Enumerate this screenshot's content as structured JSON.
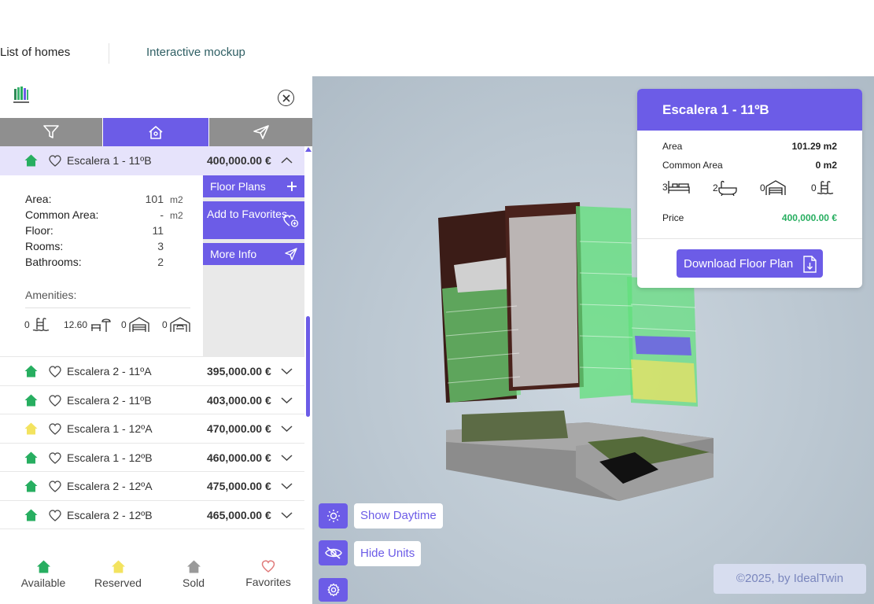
{
  "top_tabs": {
    "list": "List of homes",
    "mockup": "Interactive mockup"
  },
  "colors": {
    "accent": "#6c5ce7",
    "available": "#27ae60",
    "reserved": "#f3e35f",
    "sold": "#9a9a9a",
    "favorite": "#e07a7a"
  },
  "expanded": {
    "name": "Escalera 1 - 11ºB",
    "price": "400,000.00 €",
    "status": "available",
    "specs": [
      {
        "label": "Area:",
        "value": "101",
        "unit": "m2"
      },
      {
        "label": "Common Area:",
        "value": "-",
        "unit": "m2"
      },
      {
        "label": "Floor:",
        "value": "11",
        "unit": ""
      },
      {
        "label": "Rooms:",
        "value": "3",
        "unit": ""
      },
      {
        "label": "Bathrooms:",
        "value": "2",
        "unit": ""
      }
    ],
    "amenities_title": "Amenities:",
    "amenities": [
      {
        "value": "0",
        "icon": "pool-icon"
      },
      {
        "value": "12.60",
        "icon": "terrace-icon"
      },
      {
        "value": "0",
        "icon": "garage-icon"
      },
      {
        "value": "0",
        "icon": "storage-garage-icon"
      }
    ],
    "actions": {
      "floor_plans": "Floor Plans",
      "add_favorites": "Add to Favorites",
      "more_info": "More Info"
    }
  },
  "rows": [
    {
      "name": "Escalera 2 - 11ºA",
      "price": "395,000.00 €",
      "status": "available"
    },
    {
      "name": "Escalera 2 - 11ºB",
      "price": "403,000.00 €",
      "status": "available"
    },
    {
      "name": "Escalera 1 - 12ºA",
      "price": "470,000.00 €",
      "status": "reserved"
    },
    {
      "name": "Escalera 1 - 12ºB",
      "price": "460,000.00 €",
      "status": "available"
    },
    {
      "name": "Escalera 2 - 12ºA",
      "price": "475,000.00 €",
      "status": "available"
    },
    {
      "name": "Escalera 2 - 12ºB",
      "price": "465,000.00 €",
      "status": "available"
    }
  ],
  "legend": {
    "available": "Available",
    "reserved": "Reserved",
    "sold": "Sold",
    "favorites": "Favorites"
  },
  "info_card": {
    "title": "Escalera 1 - 11ºB",
    "area_label": "Area",
    "area_value": "101.29 m2",
    "common_label": "Common Area",
    "common_value": "0 m2",
    "icons": [
      {
        "value": "3",
        "icon": "bed-icon"
      },
      {
        "value": "2",
        "icon": "bathtub-icon"
      },
      {
        "value": "0",
        "icon": "garage-icon"
      },
      {
        "value": "0",
        "icon": "pool-icon"
      }
    ],
    "price_label": "Price",
    "price_value": "400,000.00 €",
    "download": "Download Floor Plan"
  },
  "controls": {
    "daytime": "Show Daytime",
    "hide_units": "Hide Units"
  },
  "copyright": "©2025, by IdealTwin"
}
